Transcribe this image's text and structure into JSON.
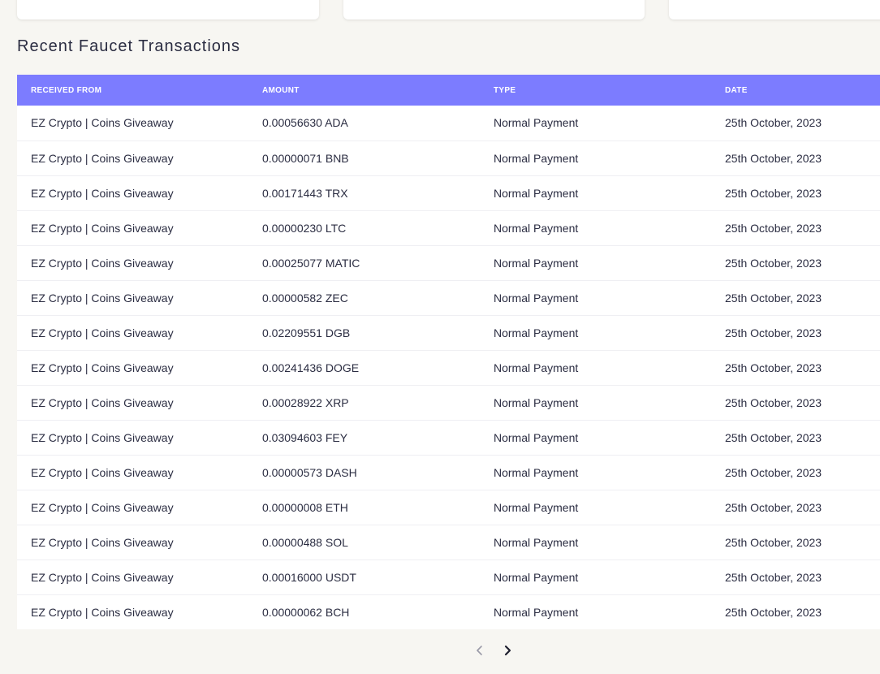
{
  "section_title": "Recent Faucet Transactions",
  "table": {
    "headers": [
      "RECEIVED FROM",
      "AMOUNT",
      "TYPE",
      "DATE"
    ],
    "rows": [
      [
        "EZ Crypto | Coins Giveaway",
        "0.00056630 ADA",
        "Normal Payment",
        "25th October, 2023"
      ],
      [
        "EZ Crypto | Coins Giveaway",
        "0.00000071 BNB",
        "Normal Payment",
        "25th October, 2023"
      ],
      [
        "EZ Crypto | Coins Giveaway",
        "0.00171443 TRX",
        "Normal Payment",
        "25th October, 2023"
      ],
      [
        "EZ Crypto | Coins Giveaway",
        "0.00000230 LTC",
        "Normal Payment",
        "25th October, 2023"
      ],
      [
        "EZ Crypto | Coins Giveaway",
        "0.00025077 MATIC",
        "Normal Payment",
        "25th October, 2023"
      ],
      [
        "EZ Crypto | Coins Giveaway",
        "0.00000582 ZEC",
        "Normal Payment",
        "25th October, 2023"
      ],
      [
        "EZ Crypto | Coins Giveaway",
        "0.02209551 DGB",
        "Normal Payment",
        "25th October, 2023"
      ],
      [
        "EZ Crypto | Coins Giveaway",
        "0.00241436 DOGE",
        "Normal Payment",
        "25th October, 2023"
      ],
      [
        "EZ Crypto | Coins Giveaway",
        "0.00028922 XRP",
        "Normal Payment",
        "25th October, 2023"
      ],
      [
        "EZ Crypto | Coins Giveaway",
        "0.03094603 FEY",
        "Normal Payment",
        "25th October, 2023"
      ],
      [
        "EZ Crypto | Coins Giveaway",
        "0.00000573 DASH",
        "Normal Payment",
        "25th October, 2023"
      ],
      [
        "EZ Crypto | Coins Giveaway",
        "0.00000008 ETH",
        "Normal Payment",
        "25th October, 2023"
      ],
      [
        "EZ Crypto | Coins Giveaway",
        "0.00000488 SOL",
        "Normal Payment",
        "25th October, 2023"
      ],
      [
        "EZ Crypto | Coins Giveaway",
        "0.00016000 USDT",
        "Normal Payment",
        "25th October, 2023"
      ],
      [
        "EZ Crypto | Coins Giveaway",
        "0.00000062 BCH",
        "Normal Payment",
        "25th October, 2023"
      ]
    ]
  },
  "pagination": {
    "prev_icon": "chevron-left-icon",
    "next_icon": "chevron-right-icon"
  },
  "colors": {
    "header_bg": "#7c7cff",
    "page_bg": "#f7f6f2",
    "text": "#2b2d42"
  }
}
